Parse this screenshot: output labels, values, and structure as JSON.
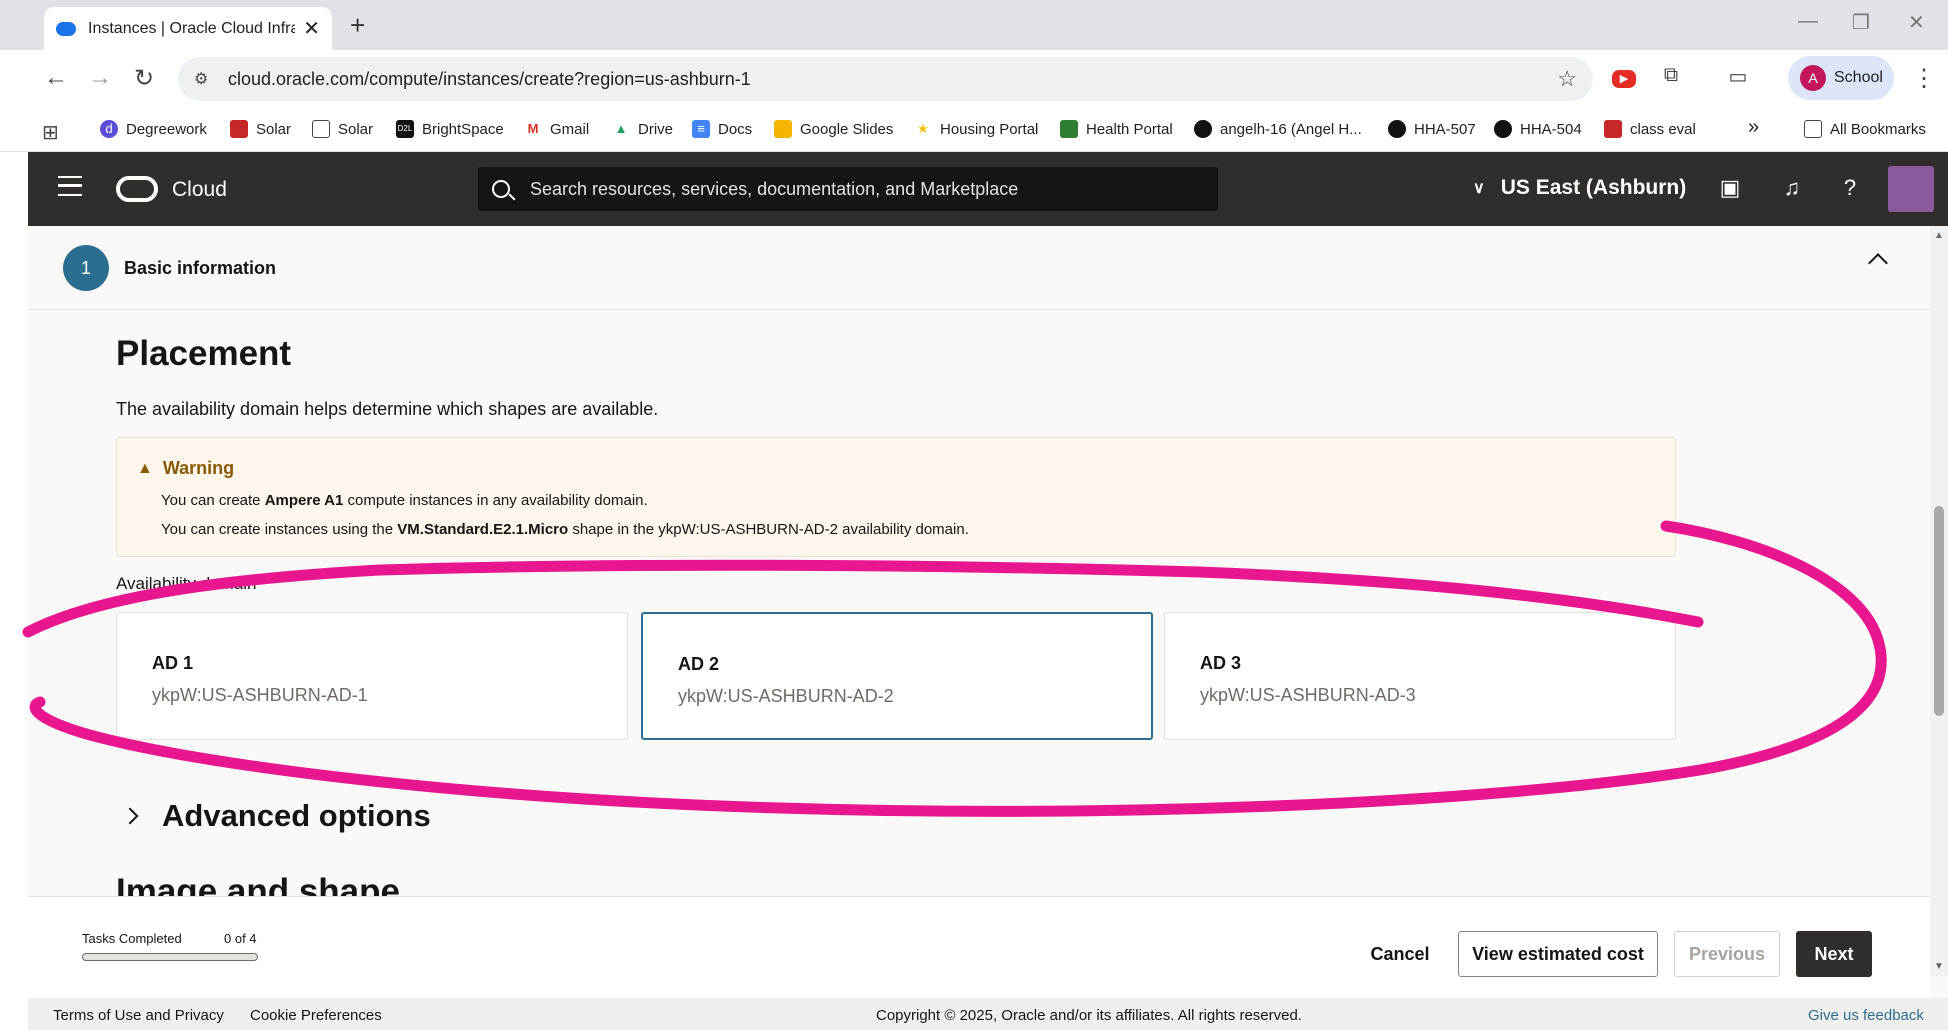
{
  "browser": {
    "tab_title": "Instances | Oracle Cloud Infrastr",
    "url": "cloud.oracle.com/compute/instances/create?region=us-ashburn-1",
    "profile_initial": "A",
    "profile_label": "School",
    "bookmarks": [
      {
        "label": "Degreework"
      },
      {
        "label": "Solar"
      },
      {
        "label": "Solar"
      },
      {
        "label": "BrightSpace"
      },
      {
        "label": "Gmail"
      },
      {
        "label": "Drive"
      },
      {
        "label": "Docs"
      },
      {
        "label": "Google Slides"
      },
      {
        "label": "Housing Portal"
      },
      {
        "label": "Health Portal"
      },
      {
        "label": "angelh-16 (Angel H..."
      },
      {
        "label": "HHA-507"
      },
      {
        "label": "HHA-504"
      },
      {
        "label": "class eval"
      }
    ],
    "all_bookmarks": "All Bookmarks",
    "more": "»"
  },
  "header": {
    "brand": "Cloud",
    "search_placeholder": "Search resources, services, documentation, and Marketplace",
    "region": "US East (Ashburn)"
  },
  "step": {
    "number": "1",
    "title": "Basic information"
  },
  "placement": {
    "heading": "Placement",
    "description": "The availability domain helps determine which shapes are available.",
    "warning_title": "Warning",
    "warning_line1_pre": "You can create ",
    "warning_line1_bold": "Ampere A1",
    "warning_line1_post": " compute instances in any availability domain.",
    "warning_line2_pre": "You can create instances using the ",
    "warning_line2_bold": "VM.Standard.E2.1.Micro",
    "warning_line2_post": " shape in the ykpW:US-ASHBURN-AD-2 availability domain.",
    "ad_label": "Availability domain",
    "domains": [
      {
        "title": "AD 1",
        "subtitle": "ykpW:US-ASHBURN-AD-1"
      },
      {
        "title": "AD 2",
        "subtitle": "ykpW:US-ASHBURN-AD-2"
      },
      {
        "title": "AD 3",
        "subtitle": "ykpW:US-ASHBURN-AD-3"
      }
    ],
    "selected_domain": "AD 2"
  },
  "advanced": "Advanced options",
  "next_section": "Image and shape",
  "footer": {
    "tasks_label": "Tasks Completed",
    "tasks_count": "0 of 4",
    "progress": 0,
    "cancel": "Cancel",
    "view_cost": "View estimated cost",
    "previous": "Previous",
    "next": "Next"
  },
  "legal": {
    "terms": "Terms of Use and Privacy",
    "cookies": "Cookie Preferences",
    "copyright": "Copyright © 2025, Oracle and/or its affiliates. All rights reserved.",
    "feedback": "Give us feedback"
  },
  "colors": {
    "accent": "#2b6e8f",
    "header_bg": "#312d2a",
    "annotation": "#e8168f"
  }
}
